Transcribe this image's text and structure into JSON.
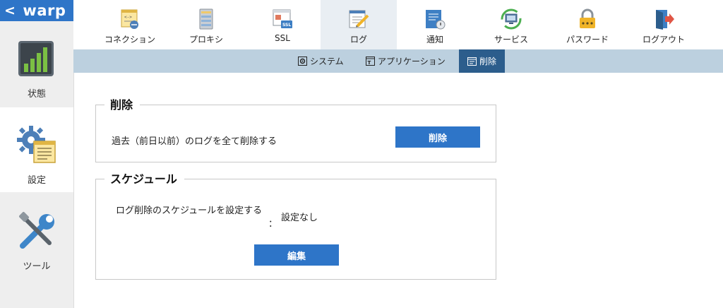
{
  "brand": {
    "back_glyph": "<",
    "name": "warp"
  },
  "sidebar": {
    "items": [
      {
        "label": "状態",
        "icon": "bar-chart-icon"
      },
      {
        "label": "設定",
        "icon": "gear-config-icon",
        "active": true
      },
      {
        "label": "ツール",
        "icon": "tools-icon"
      }
    ]
  },
  "topnav": {
    "tabs": [
      {
        "label": "コネクション",
        "icon": "connection-icon"
      },
      {
        "label": "プロキシ",
        "icon": "proxy-icon"
      },
      {
        "label": "SSL",
        "icon": "ssl-icon"
      },
      {
        "label": "ログ",
        "icon": "log-icon",
        "active": true
      },
      {
        "label": "通知",
        "icon": "notification-icon"
      },
      {
        "label": "サービス",
        "icon": "service-icon"
      },
      {
        "label": "パスワード",
        "icon": "password-lock-icon"
      },
      {
        "label": "ログアウト",
        "icon": "logout-icon"
      }
    ]
  },
  "subnav": {
    "tabs": [
      {
        "label": "システム",
        "icon": "system-icon"
      },
      {
        "label": "アプリケーション",
        "icon": "application-icon"
      },
      {
        "label": "削除",
        "icon": "delete-icon",
        "active": true
      }
    ]
  },
  "delete_section": {
    "title": "削除",
    "description": "過去（前日以前）のログを全て削除する",
    "button_label": "削除"
  },
  "schedule_section": {
    "title": "スケジュール",
    "field_label": "ログ削除のスケジュールを設定する",
    "colon": "：",
    "value": "設定なし",
    "button_label": "編集"
  },
  "colors": {
    "brand_blue": "#2e75c8",
    "subnav_bg": "#bcd0df",
    "subnav_active": "#2c5d8c",
    "tab_active_bg": "#e9eef3",
    "sidebar_bg": "#eeeeee"
  }
}
